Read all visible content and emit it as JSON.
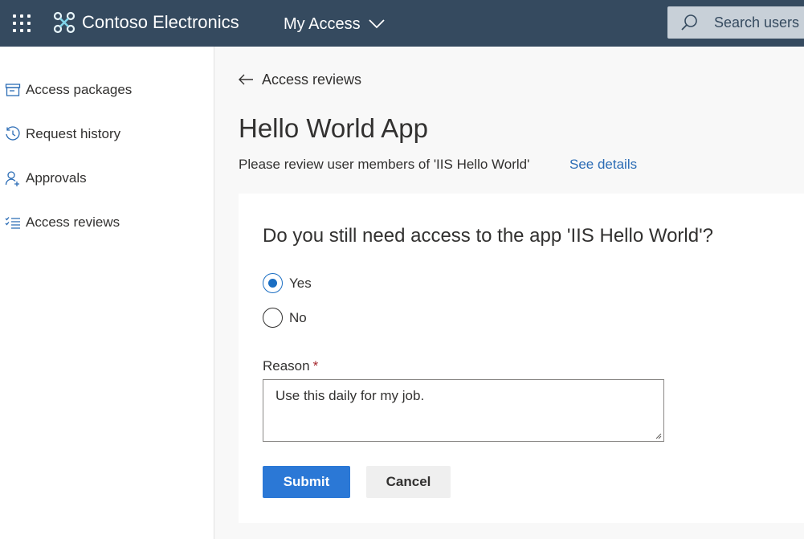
{
  "header": {
    "brand": "Contoso Electronics",
    "app_name": "My Access",
    "search_placeholder": "Search users",
    "bg_color": "#354a5f",
    "icons": [
      "waffle-icon",
      "contoso-logo-icon",
      "chevron-down-icon",
      "search-icon"
    ]
  },
  "sidebar": {
    "items": [
      {
        "label": "Access packages",
        "icon": "package-icon"
      },
      {
        "label": "Request history",
        "icon": "history-icon"
      },
      {
        "label": "Approvals",
        "icon": "person-add-icon"
      },
      {
        "label": "Access reviews",
        "icon": "checklist-icon"
      }
    ]
  },
  "main": {
    "back_label": "Access reviews",
    "title": "Hello World App",
    "subtitle": "Please review user members of 'IIS Hello World'",
    "see_details": "See details",
    "form": {
      "question": "Do you still need access to the app 'IIS Hello World'?",
      "options": [
        {
          "label": "Yes",
          "selected": true
        },
        {
          "label": "No",
          "selected": false
        }
      ],
      "reason_label": "Reason",
      "required_marker": "*",
      "reason_value": "Use this daily for my job.",
      "submit_label": "Submit",
      "cancel_label": "Cancel",
      "accent_color": "#2b78d6"
    }
  }
}
